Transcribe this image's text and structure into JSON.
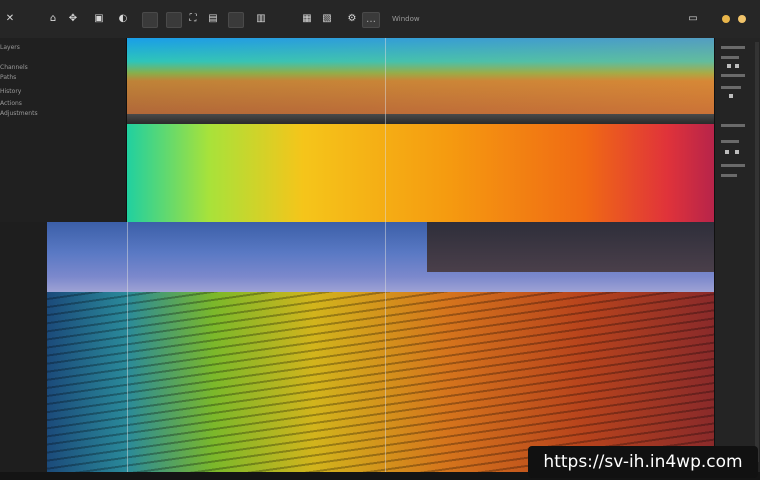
{
  "toolbar": {
    "label_text": "Window"
  },
  "left_panel": {
    "items": [
      "Layers",
      "Channels",
      "Paths",
      "History",
      "Actions",
      "Adjustments"
    ]
  },
  "right_panel": {
    "icons": [
      "gear-icon",
      "settings-icon",
      "close-icon"
    ]
  },
  "colors": {
    "accent_dot": "#e8b54a",
    "panel_bg": "#242424",
    "toolbar_bg": "#262626"
  },
  "watermark": {
    "text": "https://sv-ih.in4wp.com"
  }
}
